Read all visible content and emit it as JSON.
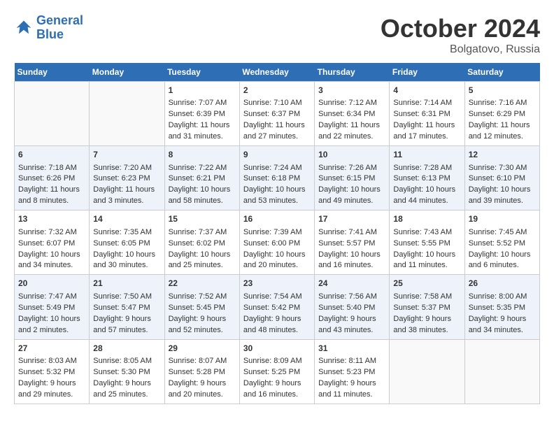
{
  "header": {
    "logo_line1": "General",
    "logo_line2": "Blue",
    "month": "October 2024",
    "location": "Bolgatovo, Russia"
  },
  "weekdays": [
    "Sunday",
    "Monday",
    "Tuesday",
    "Wednesday",
    "Thursday",
    "Friday",
    "Saturday"
  ],
  "weeks": [
    [
      {
        "day": "",
        "sunrise": "",
        "sunset": "",
        "daylight": ""
      },
      {
        "day": "",
        "sunrise": "",
        "sunset": "",
        "daylight": ""
      },
      {
        "day": "1",
        "sunrise": "Sunrise: 7:07 AM",
        "sunset": "Sunset: 6:39 PM",
        "daylight": "Daylight: 11 hours and 31 minutes."
      },
      {
        "day": "2",
        "sunrise": "Sunrise: 7:10 AM",
        "sunset": "Sunset: 6:37 PM",
        "daylight": "Daylight: 11 hours and 27 minutes."
      },
      {
        "day": "3",
        "sunrise": "Sunrise: 7:12 AM",
        "sunset": "Sunset: 6:34 PM",
        "daylight": "Daylight: 11 hours and 22 minutes."
      },
      {
        "day": "4",
        "sunrise": "Sunrise: 7:14 AM",
        "sunset": "Sunset: 6:31 PM",
        "daylight": "Daylight: 11 hours and 17 minutes."
      },
      {
        "day": "5",
        "sunrise": "Sunrise: 7:16 AM",
        "sunset": "Sunset: 6:29 PM",
        "daylight": "Daylight: 11 hours and 12 minutes."
      }
    ],
    [
      {
        "day": "6",
        "sunrise": "Sunrise: 7:18 AM",
        "sunset": "Sunset: 6:26 PM",
        "daylight": "Daylight: 11 hours and 8 minutes."
      },
      {
        "day": "7",
        "sunrise": "Sunrise: 7:20 AM",
        "sunset": "Sunset: 6:23 PM",
        "daylight": "Daylight: 11 hours and 3 minutes."
      },
      {
        "day": "8",
        "sunrise": "Sunrise: 7:22 AM",
        "sunset": "Sunset: 6:21 PM",
        "daylight": "Daylight: 10 hours and 58 minutes."
      },
      {
        "day": "9",
        "sunrise": "Sunrise: 7:24 AM",
        "sunset": "Sunset: 6:18 PM",
        "daylight": "Daylight: 10 hours and 53 minutes."
      },
      {
        "day": "10",
        "sunrise": "Sunrise: 7:26 AM",
        "sunset": "Sunset: 6:15 PM",
        "daylight": "Daylight: 10 hours and 49 minutes."
      },
      {
        "day": "11",
        "sunrise": "Sunrise: 7:28 AM",
        "sunset": "Sunset: 6:13 PM",
        "daylight": "Daylight: 10 hours and 44 minutes."
      },
      {
        "day": "12",
        "sunrise": "Sunrise: 7:30 AM",
        "sunset": "Sunset: 6:10 PM",
        "daylight": "Daylight: 10 hours and 39 minutes."
      }
    ],
    [
      {
        "day": "13",
        "sunrise": "Sunrise: 7:32 AM",
        "sunset": "Sunset: 6:07 PM",
        "daylight": "Daylight: 10 hours and 34 minutes."
      },
      {
        "day": "14",
        "sunrise": "Sunrise: 7:35 AM",
        "sunset": "Sunset: 6:05 PM",
        "daylight": "Daylight: 10 hours and 30 minutes."
      },
      {
        "day": "15",
        "sunrise": "Sunrise: 7:37 AM",
        "sunset": "Sunset: 6:02 PM",
        "daylight": "Daylight: 10 hours and 25 minutes."
      },
      {
        "day": "16",
        "sunrise": "Sunrise: 7:39 AM",
        "sunset": "Sunset: 6:00 PM",
        "daylight": "Daylight: 10 hours and 20 minutes."
      },
      {
        "day": "17",
        "sunrise": "Sunrise: 7:41 AM",
        "sunset": "Sunset: 5:57 PM",
        "daylight": "Daylight: 10 hours and 16 minutes."
      },
      {
        "day": "18",
        "sunrise": "Sunrise: 7:43 AM",
        "sunset": "Sunset: 5:55 PM",
        "daylight": "Daylight: 10 hours and 11 minutes."
      },
      {
        "day": "19",
        "sunrise": "Sunrise: 7:45 AM",
        "sunset": "Sunset: 5:52 PM",
        "daylight": "Daylight: 10 hours and 6 minutes."
      }
    ],
    [
      {
        "day": "20",
        "sunrise": "Sunrise: 7:47 AM",
        "sunset": "Sunset: 5:49 PM",
        "daylight": "Daylight: 10 hours and 2 minutes."
      },
      {
        "day": "21",
        "sunrise": "Sunrise: 7:50 AM",
        "sunset": "Sunset: 5:47 PM",
        "daylight": "Daylight: 9 hours and 57 minutes."
      },
      {
        "day": "22",
        "sunrise": "Sunrise: 7:52 AM",
        "sunset": "Sunset: 5:45 PM",
        "daylight": "Daylight: 9 hours and 52 minutes."
      },
      {
        "day": "23",
        "sunrise": "Sunrise: 7:54 AM",
        "sunset": "Sunset: 5:42 PM",
        "daylight": "Daylight: 9 hours and 48 minutes."
      },
      {
        "day": "24",
        "sunrise": "Sunrise: 7:56 AM",
        "sunset": "Sunset: 5:40 PM",
        "daylight": "Daylight: 9 hours and 43 minutes."
      },
      {
        "day": "25",
        "sunrise": "Sunrise: 7:58 AM",
        "sunset": "Sunset: 5:37 PM",
        "daylight": "Daylight: 9 hours and 38 minutes."
      },
      {
        "day": "26",
        "sunrise": "Sunrise: 8:00 AM",
        "sunset": "Sunset: 5:35 PM",
        "daylight": "Daylight: 9 hours and 34 minutes."
      }
    ],
    [
      {
        "day": "27",
        "sunrise": "Sunrise: 8:03 AM",
        "sunset": "Sunset: 5:32 PM",
        "daylight": "Daylight: 9 hours and 29 minutes."
      },
      {
        "day": "28",
        "sunrise": "Sunrise: 8:05 AM",
        "sunset": "Sunset: 5:30 PM",
        "daylight": "Daylight: 9 hours and 25 minutes."
      },
      {
        "day": "29",
        "sunrise": "Sunrise: 8:07 AM",
        "sunset": "Sunset: 5:28 PM",
        "daylight": "Daylight: 9 hours and 20 minutes."
      },
      {
        "day": "30",
        "sunrise": "Sunrise: 8:09 AM",
        "sunset": "Sunset: 5:25 PM",
        "daylight": "Daylight: 9 hours and 16 minutes."
      },
      {
        "day": "31",
        "sunrise": "Sunrise: 8:11 AM",
        "sunset": "Sunset: 5:23 PM",
        "daylight": "Daylight: 9 hours and 11 minutes."
      },
      {
        "day": "",
        "sunrise": "",
        "sunset": "",
        "daylight": ""
      },
      {
        "day": "",
        "sunrise": "",
        "sunset": "",
        "daylight": ""
      }
    ]
  ]
}
